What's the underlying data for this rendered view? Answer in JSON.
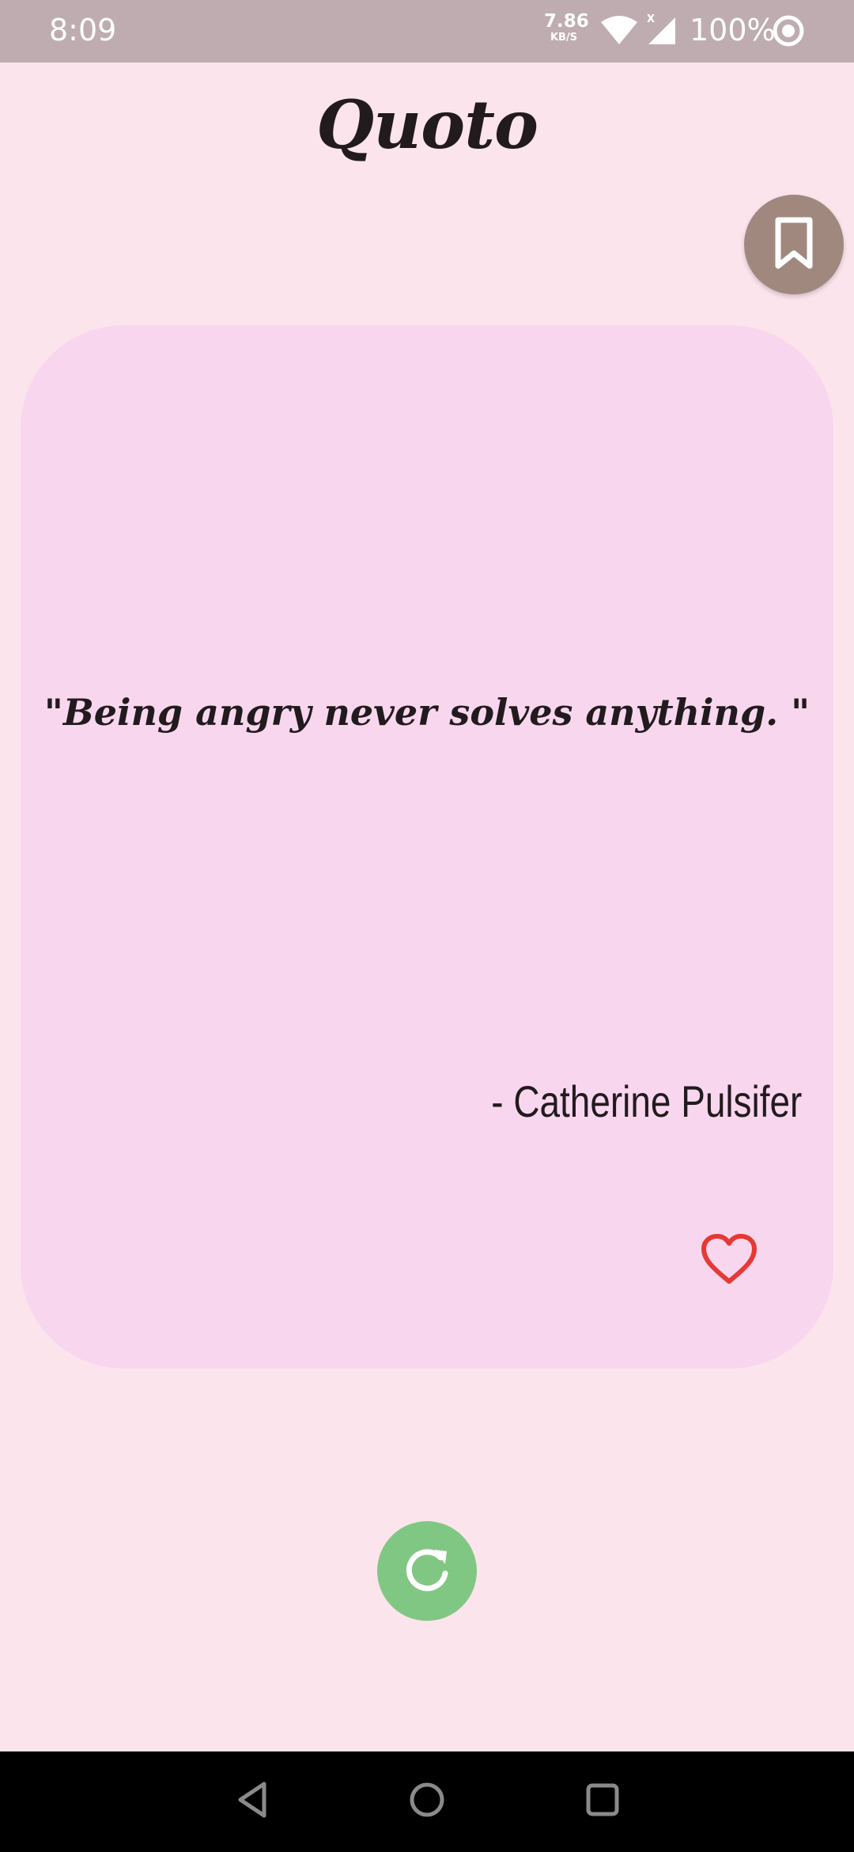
{
  "status_bar": {
    "time": "8:09",
    "net_speed_value": "7.86",
    "net_speed_unit": "KB/S",
    "signal_label": "X",
    "battery": "100%",
    "icons": [
      "wifi-icon",
      "signal-icon",
      "circle-status-icon"
    ],
    "background": "#bfacb1"
  },
  "app": {
    "title": "Quoto"
  },
  "bookmark_button": {
    "icon": "bookmark-icon",
    "color": "#a1887f"
  },
  "quote_card": {
    "quote": "\"Being angry never solves anything. \"",
    "author": "- Catherine Pulsifer",
    "favorite_icon": "heart-outline-icon",
    "favorite_color": "#e53935",
    "background": "#f8d7ee"
  },
  "refresh_button": {
    "icon": "refresh-icon",
    "color": "#81c784"
  },
  "nav_bar": {
    "items": [
      "back-icon",
      "home-icon",
      "recents-icon"
    ]
  },
  "colors": {
    "page_background": "#fce4ec",
    "text": "#221b1e"
  }
}
